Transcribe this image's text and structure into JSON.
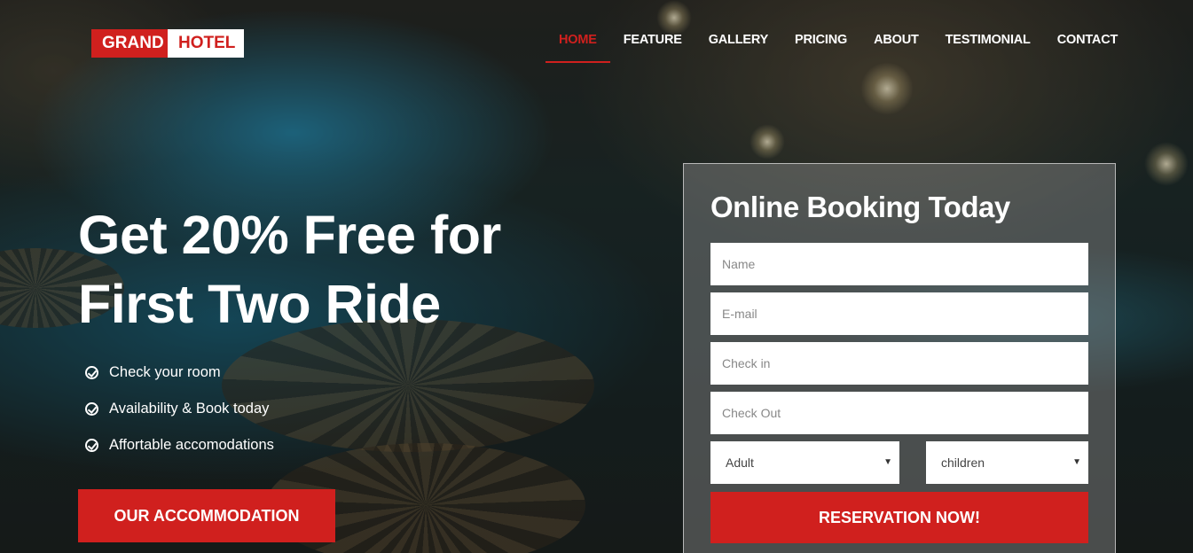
{
  "brand": {
    "part1": "GRAND",
    "part2": "HOTEL",
    "accent": "#d0201e"
  },
  "nav": {
    "items": [
      {
        "label": "HOME"
      },
      {
        "label": "FEATURE"
      },
      {
        "label": "GALLERY"
      },
      {
        "label": "PRICING"
      },
      {
        "label": "ABOUT"
      },
      {
        "label": "TESTIMONIAL"
      },
      {
        "label": "CONTACT"
      }
    ],
    "active": "HOME"
  },
  "hero": {
    "title_line1": "Get 20% Free for",
    "title_line2": "First Two Ride",
    "features": [
      {
        "icon": "check-circle-icon",
        "text": "Check your room"
      },
      {
        "icon": "check-circle-icon",
        "text": "Availability & Book today"
      },
      {
        "icon": "check-circle-icon",
        "text": "Affortable accomodations"
      }
    ],
    "cta_label": "OUR ACCOMMODATION"
  },
  "booking": {
    "title": "Online Booking Today",
    "name_placeholder": "Name",
    "email_placeholder": "E-mail",
    "checkin_placeholder": "Check in",
    "checkout_placeholder": "Check Out",
    "adult_value": "Adult",
    "children_value": "children",
    "submit_label": "RESERVATION NOW!"
  }
}
